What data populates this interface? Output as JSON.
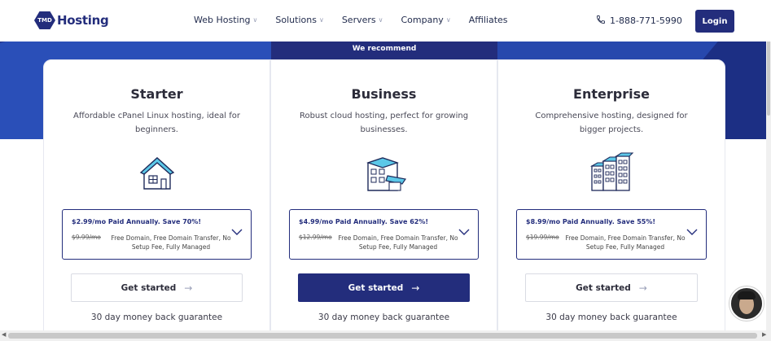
{
  "header": {
    "logo_badge": "TMD",
    "logo_text": "Hosting",
    "nav": [
      {
        "label": "Web Hosting",
        "has_dropdown": true
      },
      {
        "label": "Solutions",
        "has_dropdown": true
      },
      {
        "label": "Servers",
        "has_dropdown": true
      },
      {
        "label": "Company",
        "has_dropdown": true
      },
      {
        "label": "Affiliates",
        "has_dropdown": false
      }
    ],
    "phone": "1-888-771-5990",
    "login": "Login"
  },
  "recommend_label": "We recommend",
  "plans": [
    {
      "name": "Starter",
      "description": "Affordable cPanel Linux hosting, ideal for beginners.",
      "price_line": "$2.99/mo  Paid Annually. Save 70%!",
      "old_price": "$9.99/mo",
      "features": "Free Domain, Free Domain Transfer, No Setup Fee, Fully Managed",
      "cta": "Get started",
      "guarantee": "30 day money back guarantee",
      "illustration": "house-icon"
    },
    {
      "name": "Business",
      "description": "Robust cloud hosting, perfect for growing businesses.",
      "price_line": "$4.99/mo  Paid Annually. Save 62%!",
      "old_price": "$12.99/mo",
      "features": "Free Domain, Free Domain Transfer, No Setup Fee, Fully Managed",
      "cta": "Get started",
      "guarantee": "30 day money back guarantee",
      "illustration": "shop-icon"
    },
    {
      "name": "Enterprise",
      "description": "Comprehensive hosting, designed for bigger projects.",
      "price_line": "$8.99/mo  Paid Annually. Save 55%!",
      "old_price": "$19.99/mo",
      "features": "Free Domain, Free Domain Transfer, No Setup Fee, Fully Managed",
      "cta": "Get started",
      "guarantee": "30 day money back guarantee",
      "illustration": "buildings-icon"
    }
  ],
  "colors": {
    "brand": "#232d7c",
    "band": "#233894"
  }
}
